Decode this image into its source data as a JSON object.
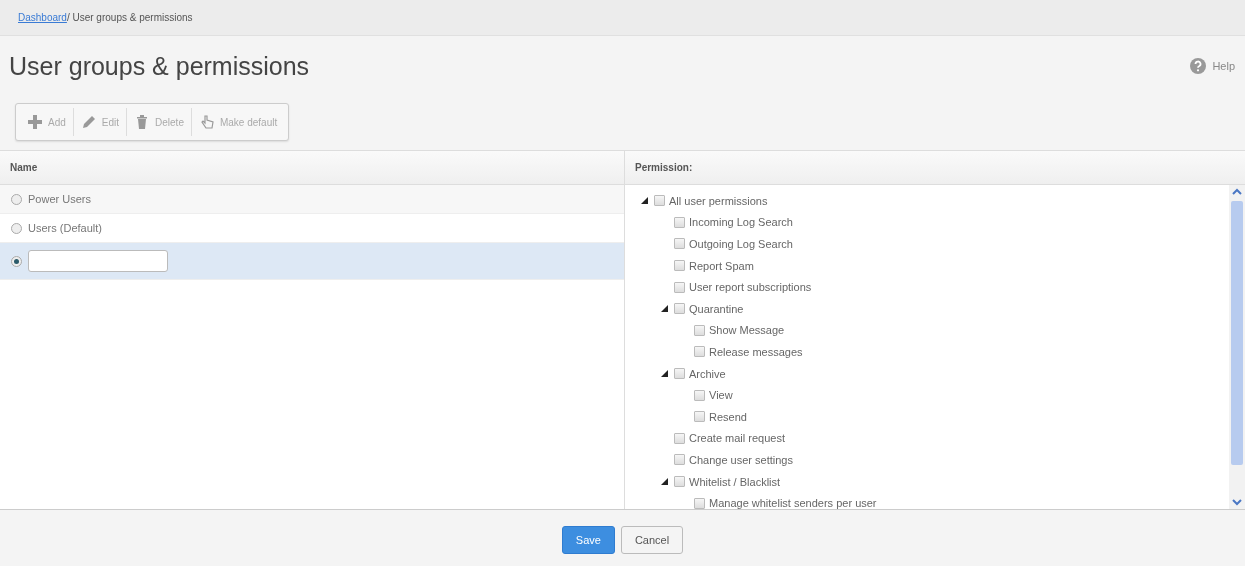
{
  "breadcrumb": {
    "link": "Dashboard",
    "current": " / User groups & permissions"
  },
  "page_title": "User groups & permissions",
  "help": {
    "label": "Help"
  },
  "toolbar": [
    {
      "kind": "add",
      "label": "Add",
      "disabled": true
    },
    {
      "kind": "edit",
      "label": "Edit",
      "disabled": true
    },
    {
      "kind": "delete",
      "label": "Delete",
      "disabled": true
    },
    {
      "kind": "default",
      "label": "Make default",
      "disabled": true
    }
  ],
  "groups": {
    "column": "Name",
    "rows": [
      {
        "kind": "label",
        "label": "Power Users",
        "selected": false
      },
      {
        "kind": "label",
        "label": "Users (Default)",
        "selected": false
      },
      {
        "kind": "input",
        "selected": true
      }
    ]
  },
  "permissions": {
    "column": "Permission:",
    "tree": [
      {
        "label": "All user permissions",
        "checked": false,
        "expanded": true,
        "children": [
          {
            "label": "Incoming Log Search",
            "checked": false
          },
          {
            "label": "Outgoing Log Search",
            "checked": false
          },
          {
            "label": "Report Spam",
            "checked": false
          },
          {
            "label": "User report subscriptions",
            "checked": false
          },
          {
            "label": "Quarantine",
            "checked": false,
            "expanded": true,
            "children": [
              {
                "label": "Show Message",
                "checked": false
              },
              {
                "label": "Release messages",
                "checked": false
              }
            ]
          },
          {
            "label": "Archive",
            "checked": false,
            "expanded": true,
            "children": [
              {
                "label": "View",
                "checked": false
              },
              {
                "label": "Resend",
                "checked": false
              }
            ]
          },
          {
            "label": "Create mail request",
            "checked": false
          },
          {
            "label": "Change user settings",
            "checked": false
          },
          {
            "label": "Whitelist / Blacklist",
            "checked": false,
            "expanded": true,
            "children": [
              {
                "label": "Manage whitelist senders per user",
                "checked": false
              }
            ]
          }
        ]
      }
    ]
  },
  "footer": {
    "buttons": [
      {
        "kind": "primary",
        "label": "Save"
      },
      {
        "kind": "secondary",
        "label": "Cancel"
      }
    ]
  }
}
